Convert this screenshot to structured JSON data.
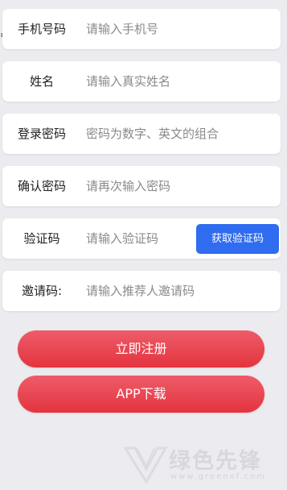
{
  "edge_text": "EV",
  "form": {
    "fields": [
      {
        "label": "手机号码",
        "placeholder": "请输入手机号"
      },
      {
        "label": "姓名",
        "placeholder": "请输入真实姓名"
      },
      {
        "label": "登录密码",
        "placeholder": "密码为数字、英文的组合"
      },
      {
        "label": "确认密码",
        "placeholder": "请再次输入密码"
      },
      {
        "label": "验证码",
        "placeholder": "请输入验证码"
      },
      {
        "label": "邀请码:",
        "placeholder": "请输入推荐人邀请码"
      }
    ],
    "get_code_label": "获取验证码"
  },
  "actions": {
    "register_label": "立即注册",
    "download_label": "APP下载"
  },
  "watermark": {
    "name": "绿色先锋",
    "url": "www.greenxf.com"
  },
  "colors": {
    "accent_blue": "#2f6cf0",
    "button_red": "#e3343f",
    "background": "#ecebef"
  }
}
